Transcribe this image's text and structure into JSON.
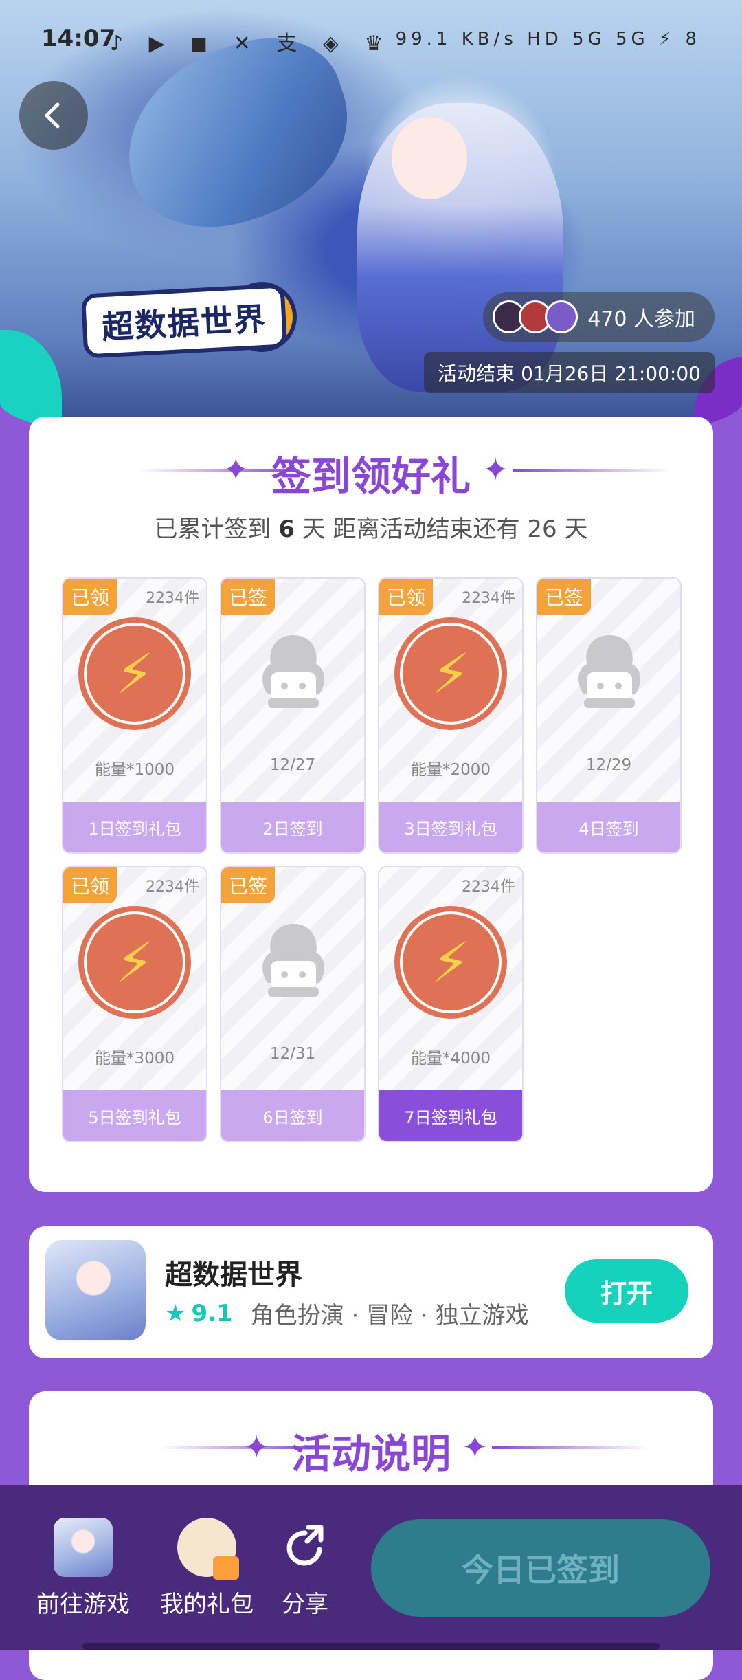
{
  "status_bar": {
    "time": "14:07",
    "icons": "♪ ▶ ◼ ✕ 支 ◈ ♛",
    "right": "99.1 KB/s HD 5G 5G ⚡ 8"
  },
  "hero": {
    "game_logo": "超数据世界",
    "participants": "470 人参加",
    "end_time": "活动结束 01月26日 21:00:00"
  },
  "signin": {
    "title": "签到领好礼",
    "summary_prefix": "已累计签到",
    "summary_days": "6",
    "summary_mid": "天  距离活动结束还有 26 天",
    "days": [
      {
        "badge": "已领",
        "count": "2234件",
        "type": "energy",
        "desc": "能量*1000",
        "footer": "1日签到礼包",
        "active": false
      },
      {
        "badge": "已签",
        "count": "",
        "type": "mascot",
        "desc": "12/27",
        "footer": "2日签到",
        "active": false
      },
      {
        "badge": "已领",
        "count": "2234件",
        "type": "energy",
        "desc": "能量*2000",
        "footer": "3日签到礼包",
        "active": false
      },
      {
        "badge": "已签",
        "count": "",
        "type": "mascot",
        "desc": "12/29",
        "footer": "4日签到",
        "active": false
      },
      {
        "badge": "已领",
        "count": "2234件",
        "type": "energy",
        "desc": "能量*3000",
        "footer": "5日签到礼包",
        "active": false
      },
      {
        "badge": "已签",
        "count": "",
        "type": "mascot",
        "desc": "12/31",
        "footer": "6日签到",
        "active": false
      },
      {
        "badge": "",
        "count": "2234件",
        "type": "energy",
        "desc": "能量*4000",
        "footer": "7日签到礼包",
        "active": true
      }
    ]
  },
  "game": {
    "name": "超数据世界",
    "rating": "9.1",
    "tags": "角色扮演 · 冒险 · 独立游戏",
    "open_label": "打开"
  },
  "rules": {
    "title": "活动说明"
  },
  "bottom_nav": {
    "go_game": "前往游戏",
    "my_gifts": "我的礼包",
    "share": "分享",
    "checkin_label": "今日已签到"
  },
  "colors": {
    "page_bg": "#8e58d6",
    "accent_purple": "#8a47d6",
    "accent_teal": "#16d2bd",
    "badge_orange": "#f3a33a",
    "checkin_btn": "#2e7c8c"
  }
}
